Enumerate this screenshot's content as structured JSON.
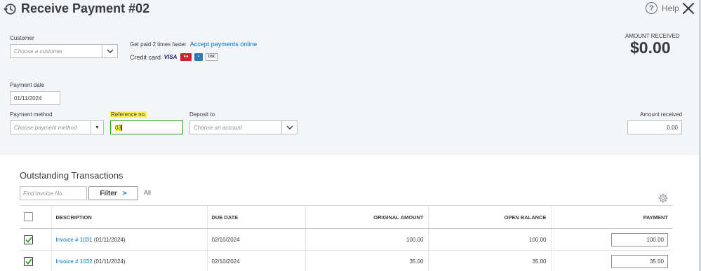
{
  "header": {
    "title": "Receive Payment #02",
    "help_label": "Help",
    "icon": "history-icon",
    "close_icon": "close-icon"
  },
  "customer": {
    "label": "Customer",
    "placeholder": "Choose a customer"
  },
  "promo": {
    "fast_text": "Get paid 2 times faster",
    "link": "Accept payments online",
    "credit_card_label": "Credit card",
    "cards": [
      "VISA",
      "MC",
      "AMEX",
      "DISCOVER"
    ]
  },
  "amount_received_display": {
    "label": "AMOUNT RECEIVED",
    "value": "$0.00"
  },
  "payment_date": {
    "label": "Payment date",
    "value": "01/11/2024"
  },
  "payment_method": {
    "label": "Payment method",
    "placeholder": "Choose payment method"
  },
  "reference": {
    "label": "Reference no.",
    "value": "03"
  },
  "deposit_to": {
    "label": "Deposit to",
    "placeholder": "Choose an account"
  },
  "amount_received_field": {
    "label": "Amount received",
    "value": "0.00"
  },
  "outstanding": {
    "title": "Outstanding Transactions",
    "find_placeholder": "Find Invoice No.",
    "filter_label": "Filter",
    "all_label": "All",
    "columns": {
      "description": "DESCRIPTION",
      "due_date": "DUE DATE",
      "original_amount": "ORIGINAL AMOUNT",
      "open_balance": "OPEN BALANCE",
      "payment": "PAYMENT"
    },
    "rows": [
      {
        "checked": true,
        "invoice": "Invoice # 1031",
        "date": "(01/11/2024)",
        "due_date": "02/10/2024",
        "original_amount": "100.00",
        "open_balance": "100.00",
        "payment": "100.00"
      },
      {
        "checked": true,
        "invoice": "Invoice # 1032",
        "date": "(01/11/2024)",
        "due_date": "02/10/2024",
        "original_amount": "35.00",
        "open_balance": "35.00",
        "payment": "35.00"
      }
    ]
  },
  "colors": {
    "accent_link": "#0077c5",
    "active_border": "#2ca01c",
    "highlight": "#fbf34a",
    "panel_bg": "#f4f5f8"
  }
}
